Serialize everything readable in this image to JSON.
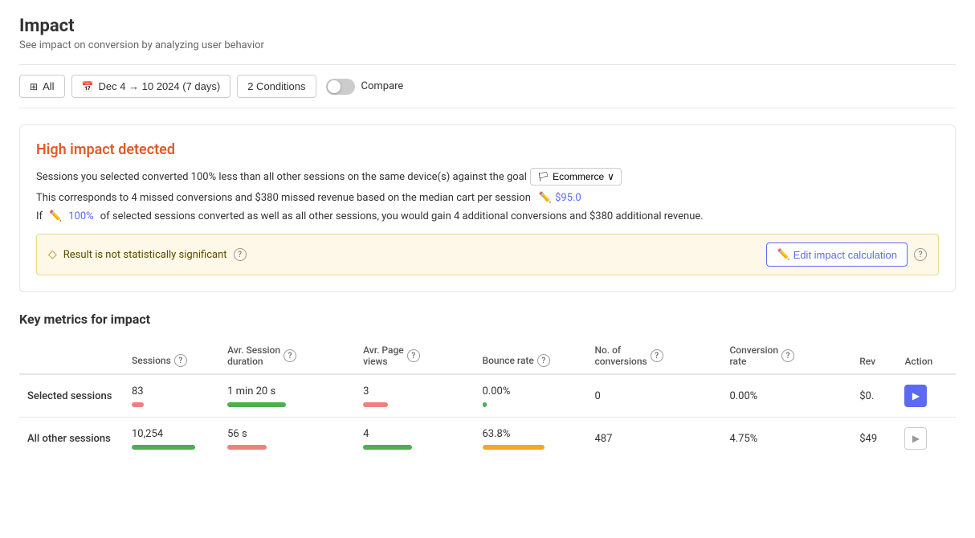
{
  "page": {
    "title": "Impact",
    "subtitle": "See impact on conversion by analyzing user behavior"
  },
  "filterBar": {
    "allBtn": "All",
    "dateBtn": "Dec 4 → 10 2024 (7 days)",
    "conditionsBtn": "2 Conditions",
    "compareLabel": "Compare"
  },
  "impactCard": {
    "title": "High impact detected",
    "line1_pre": "Sessions you selected converted 100% less than all other sessions on the same device(s) against the goal",
    "goalLabel": "🏳 Ecommerce",
    "line2_pre": "This corresponds to 4 missed conversions and $380 missed revenue based on the median cart per session",
    "line2_edit": "$95.0",
    "line3_pre": "If",
    "line3_pct": "100%",
    "line3_post": "of selected sessions converted as well as all other sessions, you would gain 4 additional conversions and $380 additional revenue.",
    "warningText": "Result is not statistically significant",
    "editCalcBtn": "Edit impact calculation"
  },
  "metricsSection": {
    "title": "Key metrics for impact",
    "columns": [
      {
        "label": "Sessions",
        "help": true
      },
      {
        "label": "Avr. Session duration",
        "help": true
      },
      {
        "label": "",
        "help": false
      },
      {
        "label": "Avr. Page views",
        "help": true
      },
      {
        "label": "",
        "help": false
      },
      {
        "label": "Bounce rate",
        "help": true
      },
      {
        "label": "No. of conversions",
        "help": true
      },
      {
        "label": "",
        "help": false
      },
      {
        "label": "Conversion rate",
        "help": true
      },
      {
        "label": "",
        "help": false
      },
      {
        "label": "Rev",
        "help": false
      },
      {
        "label": "Action",
        "help": false
      }
    ],
    "rows": [
      {
        "label": "Selected sessions",
        "sessions": "83",
        "avrSession": "1 min 20 s",
        "avrPages": "3",
        "bounceRate": "0.00%",
        "conversions": "0",
        "conversionRate": "0.00%",
        "revenue": "$0.",
        "barSessions": {
          "width": 15,
          "color": "red"
        },
        "barAvrSession": {
          "width": 60,
          "color": "green"
        },
        "barAvrPages": {
          "width": 30,
          "color": "red"
        },
        "barBounce": {
          "width": 5,
          "color": "green"
        },
        "actionType": "primary"
      },
      {
        "label": "All other sessions",
        "sessions": "10,254",
        "avrSession": "56 s",
        "avrPages": "4",
        "bounceRate": "63.8%",
        "conversions": "487",
        "conversionRate": "4.75%",
        "revenue": "$49",
        "barSessions": {
          "width": 80,
          "color": "green"
        },
        "barAvrSession": {
          "width": 40,
          "color": "red"
        },
        "barAvrPages": {
          "width": 60,
          "color": "green"
        },
        "barBounce": {
          "width": 70,
          "color": "orange"
        },
        "actionType": "secondary"
      }
    ]
  }
}
